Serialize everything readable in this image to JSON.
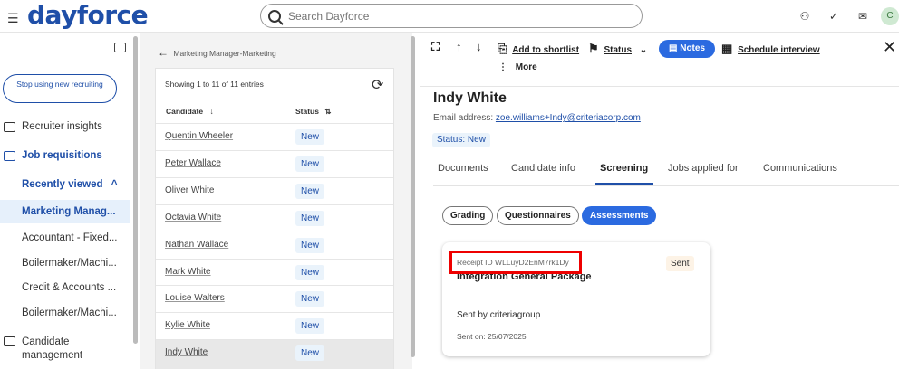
{
  "app": {
    "logo": "dayforce",
    "avatar_initial": "C"
  },
  "search": {
    "placeholder": "Search Dayforce"
  },
  "leftnav": {
    "stop_button": "Stop using new recruiting",
    "items": [
      {
        "label": "Recruiter insights"
      },
      {
        "label": "Job requisitions"
      },
      {
        "label": "Recently viewed"
      },
      {
        "label": "Marketing Manag..."
      },
      {
        "label": "Accountant - Fixed..."
      },
      {
        "label": "Boilermaker/Machi..."
      },
      {
        "label": "Credit & Accounts ..."
      },
      {
        "label": "Boilermaker/Machi..."
      },
      {
        "label": "Candidate management"
      }
    ]
  },
  "list": {
    "breadcrumb": "Marketing Manager-Marketing",
    "showing": "Showing 1 to 11 of 11 entries",
    "col_candidate": "Candidate",
    "col_status": "Status",
    "rows": [
      {
        "name": "Quentin Wheeler",
        "status": "New"
      },
      {
        "name": "Peter Wallace",
        "status": "New"
      },
      {
        "name": "Oliver White",
        "status": "New"
      },
      {
        "name": "Octavia White",
        "status": "New"
      },
      {
        "name": "Nathan Wallace",
        "status": "New"
      },
      {
        "name": "Mark White",
        "status": "New"
      },
      {
        "name": "Louise Walters",
        "status": "New"
      },
      {
        "name": "Kylie White",
        "status": "New"
      },
      {
        "name": "Indy White",
        "status": "New"
      }
    ]
  },
  "toolbar": {
    "add_shortlist": "Add to shortlist",
    "status": "Status",
    "notes": "Notes",
    "schedule": "Schedule interview",
    "more": "More"
  },
  "candidate": {
    "name": "Indy White",
    "email_label": "Email address:",
    "email": "zoe.williams+Indy@criteriacorp.com",
    "status": "Status: New"
  },
  "tabs": [
    "Documents",
    "Candidate info",
    "Screening",
    "Jobs applied for",
    "Communications"
  ],
  "pills": [
    "Grading",
    "Questionnaires",
    "Assessments"
  ],
  "assessment": {
    "receipt": "Receipt ID WLLuyD2EnM7rk1Dy",
    "title": "Integration General Package",
    "badge": "Sent",
    "sent_by": "Sent by criteriagroup",
    "sent_on": "Sent on: 25/07/2025"
  },
  "colors": {
    "brand": "#1f4fa8",
    "accent": "#2b6ae0",
    "highlight": "#e00000"
  }
}
